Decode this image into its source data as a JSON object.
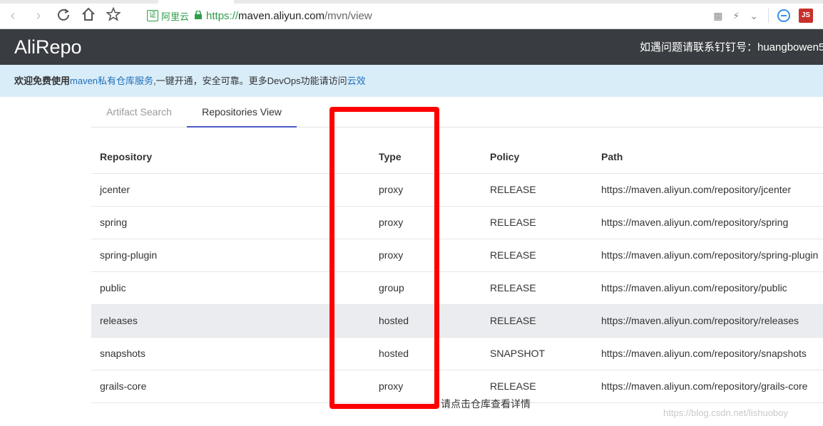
{
  "browser": {
    "back_icon": "chevron-left-icon",
    "forward_icon": "chevron-right-icon",
    "reload_icon": "reload-icon",
    "home_icon": "home-icon",
    "star_icon": "star-icon",
    "cert_badge": "证",
    "cert_name": "阿里云",
    "url_scheme": "https://",
    "url_host": "maven.aliyun.com",
    "url_path": "/mvn/view",
    "js_extension_label": "JS"
  },
  "header": {
    "brand": "AliRepo",
    "contact": "如遇问题请联系钉钉号：huangbowen5"
  },
  "notice": {
    "bold_text": "欢迎免费使用",
    "link1": "maven私有仓库服务",
    "middle_text": ",一键开通，安全可靠。更多DevOps功能请访问",
    "link2": "云效"
  },
  "tabs": {
    "artifact_search": "Artifact Search",
    "repositories_view": "Repositories View"
  },
  "table": {
    "headers": {
      "repository": "Repository",
      "type": "Type",
      "policy": "Policy",
      "path": "Path"
    },
    "rows": [
      {
        "repository": "jcenter",
        "type": "proxy",
        "policy": "RELEASE",
        "path": "https://maven.aliyun.com/repository/jcenter"
      },
      {
        "repository": "spring",
        "type": "proxy",
        "policy": "RELEASE",
        "path": "https://maven.aliyun.com/repository/spring"
      },
      {
        "repository": "spring-plugin",
        "type": "proxy",
        "policy": "RELEASE",
        "path": "https://maven.aliyun.com/repository/spring-plugin"
      },
      {
        "repository": "public",
        "type": "group",
        "policy": "RELEASE",
        "path": "https://maven.aliyun.com/repository/public"
      },
      {
        "repository": "releases",
        "type": "hosted",
        "policy": "RELEASE",
        "path": "https://maven.aliyun.com/repository/releases"
      },
      {
        "repository": "snapshots",
        "type": "hosted",
        "policy": "SNAPSHOT",
        "path": "https://maven.aliyun.com/repository/snapshots"
      },
      {
        "repository": "grails-core",
        "type": "proxy",
        "policy": "RELEASE",
        "path": "https://maven.aliyun.com/repository/grails-core"
      }
    ]
  },
  "hint": "请点击仓库查看详情",
  "watermark": "https://blog.csdn.net/lishuoboy",
  "colors": {
    "header_bg": "#393d41",
    "notice_bg": "#d9edf9",
    "link": "#1f6fb8",
    "tab_underline": "#4a5bc4",
    "annotation_red": "#ff0000",
    "secure_green": "#2d9d48"
  }
}
